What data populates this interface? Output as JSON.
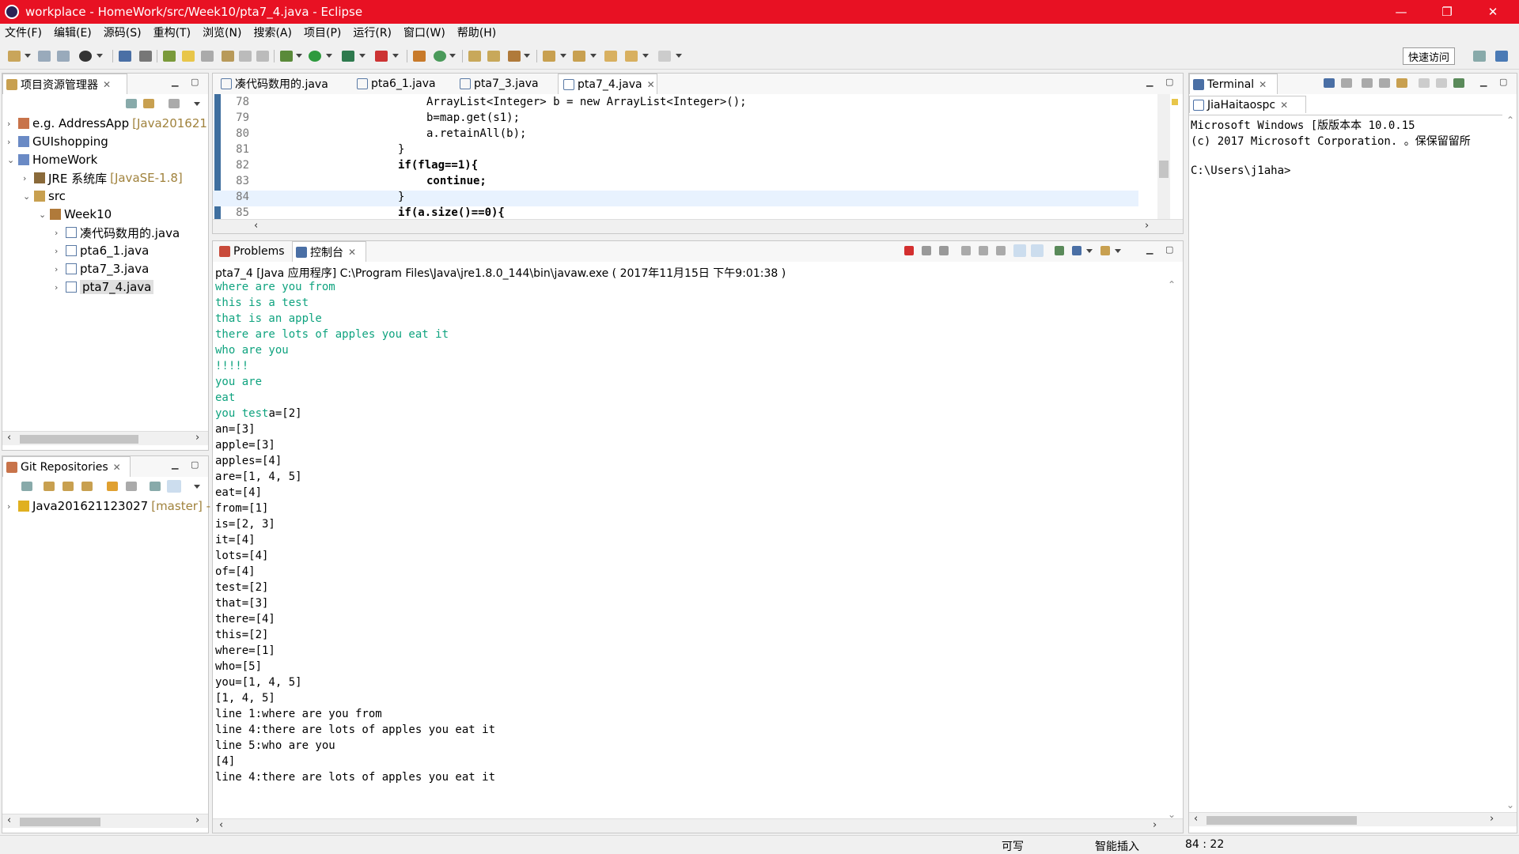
{
  "window": {
    "title": "workplace - HomeWork/src/Week10/pta7_4.java - Eclipse",
    "minimize": "—",
    "restore": "❐",
    "close": "✕"
  },
  "menu": [
    "文件(F)",
    "编辑(E)",
    "源码(S)",
    "重构(T)",
    "浏览(N)",
    "搜索(A)",
    "项目(P)",
    "运行(R)",
    "窗口(W)",
    "帮助(H)"
  ],
  "toolbar": {
    "quick_access": "快速访问"
  },
  "explorer": {
    "title": "项目资源管理器",
    "items": [
      {
        "label": "e.g. AddressApp",
        "decor": "[Java201621"
      },
      {
        "label": "GUIshopping",
        "decor": ""
      },
      {
        "label": "HomeWork",
        "decor": ""
      },
      {
        "label": "JRE 系统库",
        "decor": "[JavaSE-1.8]"
      },
      {
        "label": "src",
        "decor": ""
      },
      {
        "label": "Week10",
        "decor": ""
      },
      {
        "label": "凑代码数用的.java",
        "decor": ""
      },
      {
        "label": "pta6_1.java",
        "decor": ""
      },
      {
        "label": "pta7_3.java",
        "decor": ""
      },
      {
        "label": "pta7_4.java",
        "decor": ""
      }
    ]
  },
  "git": {
    "title": "Git Repositories",
    "repo": "Java201621123027",
    "branch": "[master] -"
  },
  "editor": {
    "tabs": [
      "凑代码数用的.java",
      "pta6_1.java",
      "pta7_3.java",
      "pta7_4.java"
    ],
    "lines": [
      {
        "num": "78",
        "text": "ArrayList<Integer> b = new ArrayList<Integer>();"
      },
      {
        "num": "79",
        "text": "b=map.get(s1);"
      },
      {
        "num": "80",
        "text": "a.retainAll(b);"
      },
      {
        "num": "81",
        "text": "}"
      },
      {
        "num": "82",
        "text": "if(flag==1){"
      },
      {
        "num": "83",
        "text": "continue;"
      },
      {
        "num": "84",
        "text": "}"
      },
      {
        "num": "85",
        "text": "if(a.size()==0){"
      }
    ]
  },
  "console": {
    "tab_problems": "Problems",
    "tab_console": "控制台",
    "header": "pta7_4 [Java 应用程序] C:\\Program Files\\Java\\jre1.8.0_144\\bin\\javaw.exe ( 2017年11月15日 下午9:01:38 )",
    "input_lines": [
      "where are you from",
      "this is a test",
      "that is an apple",
      "there are lots of apples you eat it",
      "who are you",
      "!!!!!",
      "you are",
      "eat",
      "you test"
    ],
    "first_output": "a=[2]",
    "output_lines": [
      "an=[3]",
      "apple=[3]",
      "apples=[4]",
      "are=[1, 4, 5]",
      "eat=[4]",
      "from=[1]",
      "is=[2, 3]",
      "it=[4]",
      "lots=[4]",
      "of=[4]",
      "test=[2]",
      "that=[3]",
      "there=[4]",
      "this=[2]",
      "where=[1]",
      "who=[5]",
      "you=[1, 4, 5]",
      "[1, 4, 5]",
      "line 1:where are you from",
      "line 4:there are lots of apples you eat it",
      "line 5:who are you",
      "[4]",
      "line 4:there are lots of apples you eat it"
    ]
  },
  "terminal": {
    "title": "Terminal",
    "session": "JiaHaitaospc",
    "lines": [
      "Microsoft Windows [版版本本 10.0.15",
      "(c) 2017 Microsoft Corporation. 。保保留留所",
      "",
      "C:\\Users\\j1aha>"
    ]
  },
  "status": {
    "writable": "可写",
    "insert_mode": "智能插入",
    "position": "84 : 22"
  },
  "colors": {
    "titlebar": "#e81123",
    "console_input": "#0fa37f",
    "keyword": "#7f0055",
    "ruler": "#3f6f9f"
  }
}
